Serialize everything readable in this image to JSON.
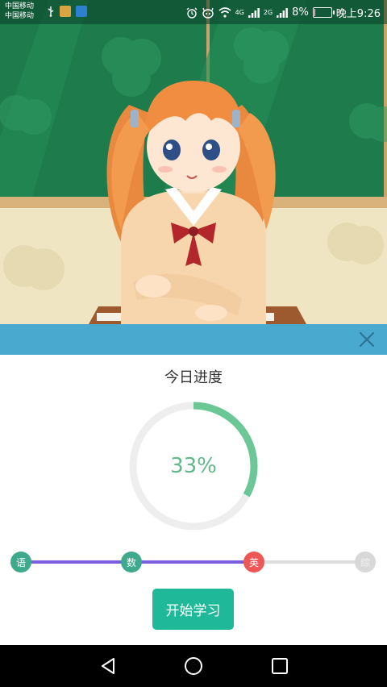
{
  "status_bar": {
    "carrier_1": "中国移动",
    "carrier_2": "中国移动",
    "signal_1_label": "4G",
    "signal_2_label": "2G",
    "battery_percent": "8%",
    "battery_level": 0.08,
    "time": "晚上9:26",
    "icons": [
      "usb-icon",
      "app-icon",
      "app-icon",
      "alarm-icon",
      "pet-icon",
      "wifi-icon",
      "signal-icon",
      "signal-icon",
      "battery-icon"
    ]
  },
  "dialog": {
    "close_icon": "close-icon",
    "title": "今日进度",
    "progress": {
      "percent_text": "33%",
      "fraction": 0.33
    },
    "steps": [
      {
        "label": "语",
        "state": "done"
      },
      {
        "label": "数",
        "state": "done"
      },
      {
        "label": "英",
        "state": "current"
      },
      {
        "label": "综",
        "state": "pending"
      }
    ],
    "start_button": "开始学习"
  },
  "colors": {
    "header": "#4aa9cf",
    "ring_progress": "#6bc795",
    "ring_track": "#eeeeee",
    "step_done": "#3fa98e",
    "step_current": "#ef5757",
    "step_pending": "#d8d8d8",
    "step_line_done": "#7a5de0",
    "step_line_pending": "#dddddd",
    "start_button": "#1fb899"
  },
  "nav_bar": {
    "icons": [
      "back-icon",
      "home-icon",
      "recents-icon"
    ]
  }
}
